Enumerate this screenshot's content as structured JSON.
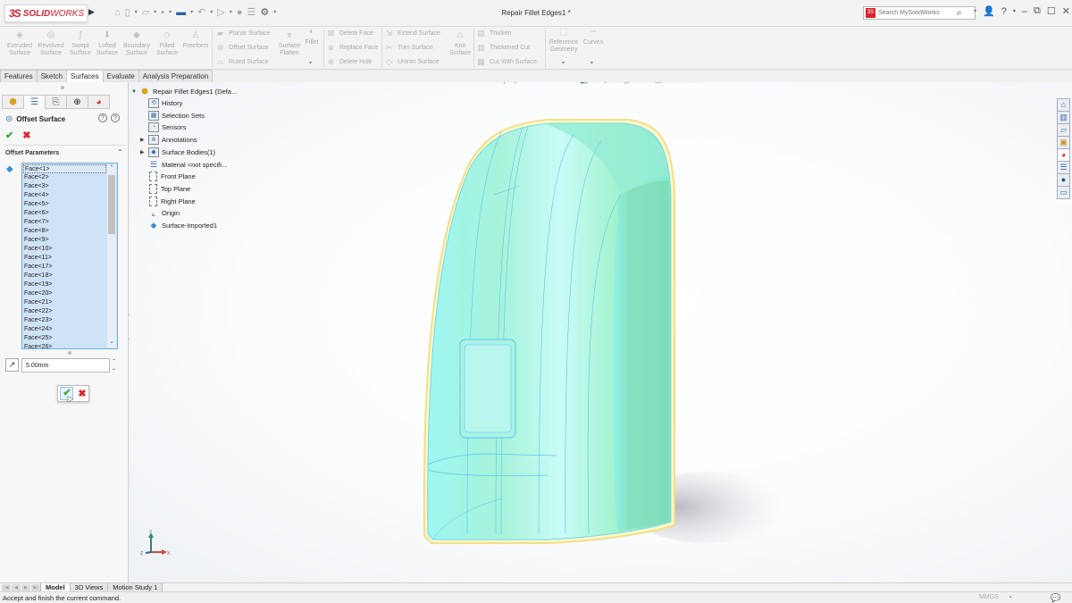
{
  "app": {
    "logo_prefix": "3S",
    "logo_brand_bold": "SOLID",
    "logo_brand_light": "WORKS",
    "document_title": "Repair Fillet Edges1 *"
  },
  "search": {
    "placeholder": "Search MySolidWorks"
  },
  "ribbon": {
    "big_buttons": [
      {
        "label1": "Extruded",
        "label2": "Surface",
        "icon": "extruded-surface-icon"
      },
      {
        "label1": "Revolved",
        "label2": "Surface",
        "icon": "revolved-surface-icon"
      },
      {
        "label1": "Swept",
        "label2": "Surface",
        "icon": "swept-surface-icon"
      },
      {
        "label1": "Lofted",
        "label2": "Surface",
        "icon": "lofted-surface-icon"
      },
      {
        "label1": "Boundary",
        "label2": "Surface",
        "icon": "boundary-surface-icon"
      },
      {
        "label1": "Filled",
        "label2": "Surface",
        "icon": "filled-surface-icon"
      },
      {
        "label1": "Freeform",
        "label2": "",
        "icon": "freeform-icon"
      }
    ],
    "group1": [
      "Planar Surface",
      "Offset Surface",
      "Ruled Surface"
    ],
    "surface_flatten": {
      "label1": "Surface",
      "label2": "Flatten"
    },
    "fillet": "Fillet",
    "group2": [
      "Delete Face",
      "Replace Face",
      "Delete Hole"
    ],
    "group3": [
      "Extend Surface",
      "Trim Surface",
      "Untrim Surface"
    ],
    "knit": {
      "label1": "Knit",
      "label2": "Surface"
    },
    "group4": [
      "Thicken",
      "Thickened Cut",
      "Cut With Surface"
    ],
    "ref_geometry": {
      "label1": "Reference",
      "label2": "Geometry"
    },
    "curves": "Curves"
  },
  "cm_tabs": [
    "Features",
    "Sketch",
    "Surfaces",
    "Evaluate",
    "Analysis Preparation"
  ],
  "cm_active_tab": "Surfaces",
  "property_manager": {
    "title": "Offset Surface",
    "section": "Offset Parameters",
    "faces": [
      "Face<1>",
      "Face<2>",
      "Face<3>",
      "Face<4>",
      "Face<5>",
      "Face<6>",
      "Face<7>",
      "Face<8>",
      "Face<9>",
      "Face<10>",
      "Face<11>",
      "Face<17>",
      "Face<18>",
      "Face<19>",
      "Face<20>",
      "Face<21>",
      "Face<22>",
      "Face<23>",
      "Face<24>",
      "Face<25>",
      "Face<26>"
    ],
    "offset_distance": "5.00mm"
  },
  "feature_tree": {
    "root": "Repair Fillet Edges1  (Defa...",
    "items": [
      {
        "label": "History",
        "icon": "history-icon",
        "expandable": false
      },
      {
        "label": "Selection Sets",
        "icon": "selection-sets-icon",
        "expandable": false
      },
      {
        "label": "Sensors",
        "icon": "sensors-icon",
        "expandable": false
      },
      {
        "label": "Annotations",
        "icon": "annotations-icon",
        "expandable": true
      },
      {
        "label": "Surface Bodies(1)",
        "icon": "surface-bodies-icon",
        "expandable": true
      },
      {
        "label": "Material <not specifi...",
        "icon": "material-icon",
        "expandable": false
      },
      {
        "label": "Front Plane",
        "icon": "plane-icon",
        "expandable": false
      },
      {
        "label": "Top Plane",
        "icon": "plane-icon",
        "expandable": false
      },
      {
        "label": "Right Plane",
        "icon": "plane-icon",
        "expandable": false
      },
      {
        "label": "Origin",
        "icon": "origin-icon",
        "expandable": false
      },
      {
        "label": "Surface-Imported1",
        "icon": "imported-surface-icon",
        "expandable": false
      }
    ]
  },
  "triad": {
    "x": "X",
    "y": "Y",
    "z": "Z"
  },
  "bottom_tabs": [
    "Model",
    "3D Views",
    "Motion Study 1"
  ],
  "bottom_active_tab": "Model",
  "status": {
    "message": "Accept and finish the current command.",
    "units": "MMGS"
  },
  "colors": {
    "brand_red": "#d9232d",
    "accept_green": "#3aa63a",
    "selection_blue": "#cfe3f7",
    "model_cyan": "#7ff0ea",
    "model_green": "#7fdcb8"
  }
}
